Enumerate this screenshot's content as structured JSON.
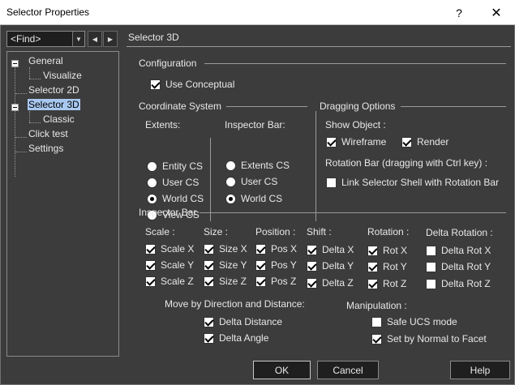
{
  "window": {
    "title": "Selector Properties",
    "help_glyph": "?",
    "close_glyph": "✕"
  },
  "find": {
    "value": "<Find>",
    "dropdown_glyph": "▼",
    "prev_glyph": "◀",
    "next_glyph": "▶"
  },
  "tree": {
    "items": [
      {
        "label": "General"
      },
      {
        "label": "Visualize"
      },
      {
        "label": "Selector 2D"
      },
      {
        "label": "Selector 3D"
      },
      {
        "label": "Classic"
      },
      {
        "label": "Click test"
      },
      {
        "label": "Settings"
      }
    ]
  },
  "page": {
    "title": "Selector 3D"
  },
  "configuration": {
    "header": "Configuration",
    "use_conceptual": {
      "label": "Use Conceptual",
      "checked": true
    }
  },
  "coordinate_system": {
    "header": "Coordinate System",
    "extents": {
      "label": "Extents:",
      "options": [
        "Entity CS",
        "User CS",
        "World CS",
        "View CS"
      ],
      "selected": "World CS"
    },
    "inspector_bar": {
      "label": "Inspector Bar:",
      "options": [
        "Extents CS",
        "User CS",
        "World CS"
      ],
      "selected": "World CS"
    }
  },
  "dragging": {
    "header": "Dragging Options",
    "show_object_label": "Show Object :",
    "wireframe": {
      "label": "Wireframe",
      "checked": true
    },
    "render": {
      "label": "Render",
      "checked": true
    },
    "rotation_bar_label": "Rotation Bar (dragging with Ctrl key) :",
    "link_shell": {
      "label": "Link Selector Shell with Rotation Bar",
      "checked": false
    }
  },
  "inspector": {
    "header": "Inspector Bar",
    "columns": [
      {
        "header": "Scale :",
        "items": [
          {
            "label": "Scale X",
            "checked": true
          },
          {
            "label": "Scale Y",
            "checked": true
          },
          {
            "label": "Scale Z",
            "checked": true
          }
        ]
      },
      {
        "header": "Size :",
        "items": [
          {
            "label": "Size X",
            "checked": true
          },
          {
            "label": "Size Y",
            "checked": true
          },
          {
            "label": "Size Z",
            "checked": true
          }
        ]
      },
      {
        "header": "Position :",
        "items": [
          {
            "label": "Pos X",
            "checked": true
          },
          {
            "label": "Pos Y",
            "checked": true
          },
          {
            "label": "Pos Z",
            "checked": true
          }
        ]
      },
      {
        "header": "Shift :",
        "items": [
          {
            "label": "Delta X",
            "checked": true
          },
          {
            "label": "Delta Y",
            "checked": true
          },
          {
            "label": "Delta Z",
            "checked": true
          }
        ]
      },
      {
        "header": "Rotation :",
        "items": [
          {
            "label": "Rot X",
            "checked": true
          },
          {
            "label": "Rot Y",
            "checked": true
          },
          {
            "label": "Rot Z",
            "checked": true
          }
        ]
      },
      {
        "header": "Delta Rotation :",
        "items": [
          {
            "label": "Delta Rot X",
            "checked": false
          },
          {
            "label": "Delta Rot Y",
            "checked": false
          },
          {
            "label": "Delta Rot Z",
            "checked": false
          }
        ]
      }
    ],
    "move_label": "Move by Direction and Distance:",
    "delta_distance": {
      "label": "Delta Distance",
      "checked": true
    },
    "delta_angle": {
      "label": "Delta Angle",
      "checked": true
    },
    "manipulation_label": "Manipulation :",
    "safe_ucs": {
      "label": "Safe UCS mode",
      "checked": false
    },
    "set_by_normal": {
      "label": "Set by Normal to Facet",
      "checked": true
    }
  },
  "buttons": {
    "ok": "OK",
    "cancel": "Cancel",
    "help": "Help"
  }
}
